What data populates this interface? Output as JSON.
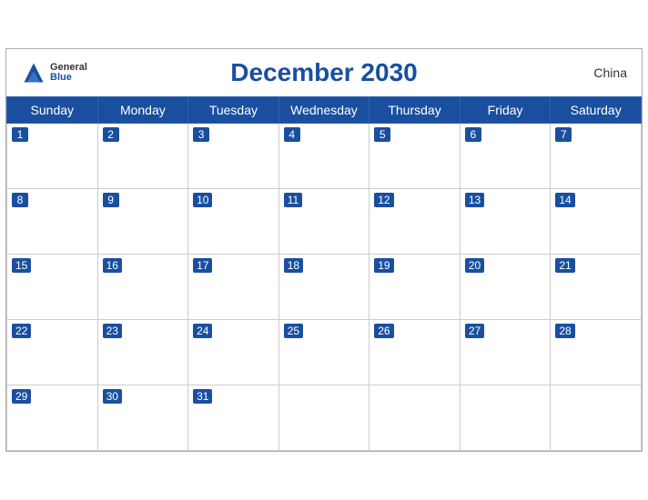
{
  "header": {
    "title": "December 2030",
    "country": "China",
    "logo_general": "General",
    "logo_blue": "Blue"
  },
  "weekdays": [
    "Sunday",
    "Monday",
    "Tuesday",
    "Wednesday",
    "Thursday",
    "Friday",
    "Saturday"
  ],
  "weeks": [
    [
      1,
      2,
      3,
      4,
      5,
      6,
      7
    ],
    [
      8,
      9,
      10,
      11,
      12,
      13,
      14
    ],
    [
      15,
      16,
      17,
      18,
      19,
      20,
      21
    ],
    [
      22,
      23,
      24,
      25,
      26,
      27,
      28
    ],
    [
      29,
      30,
      31,
      null,
      null,
      null,
      null
    ]
  ],
  "accent_color": "#1a4fa0"
}
